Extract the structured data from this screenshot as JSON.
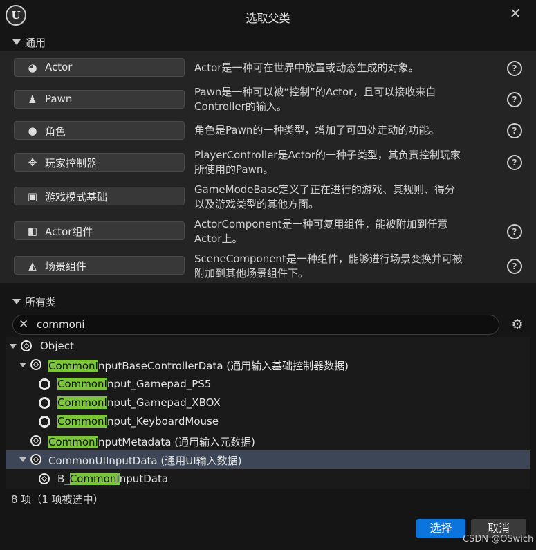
{
  "window": {
    "title": "选取父类"
  },
  "common_section": {
    "label": "通用",
    "items": [
      {
        "label": "Actor",
        "icon": "actor-icon",
        "desc": [
          "Actor是一种可在世界中放置或动态生成的对象。"
        ],
        "help": true
      },
      {
        "label": "Pawn",
        "icon": "pawn-icon",
        "desc": [
          "Pawn是一种可以被“控制”的Actor，且可以接收来自",
          "Controller的输入。"
        ],
        "help": true
      },
      {
        "label": "角色",
        "icon": "character-icon",
        "desc": [
          "角色是Pawn的一种类型，增加了可四处走动的功能。"
        ],
        "help": true
      },
      {
        "label": "玩家控制器",
        "icon": "gamepad-icon",
        "desc": [
          "PlayerController是Actor的一种子类型，其负责控制玩家",
          "所使用的Pawn。"
        ],
        "help": true
      },
      {
        "label": "游戏模式基础",
        "icon": "game-mode-icon",
        "desc": [
          "GameModeBase定义了正在进行的游戏、其规则、得分",
          "以及游戏类型的其他方面。"
        ],
        "help": false
      },
      {
        "label": "Actor组件",
        "icon": "component-icon",
        "desc": [
          "ActorComponent是一种可复用组件，能被附加到任意",
          "Actor上。"
        ],
        "help": true
      },
      {
        "label": "场景组件",
        "icon": "scene-component-icon",
        "desc": [
          "SceneComponent是一种组件，能够进行场景变换并可被",
          "附加到其他场景组件下。"
        ],
        "help": true
      }
    ]
  },
  "all_classes": {
    "label": "所有类",
    "search_value": "commoni",
    "tree": [
      {
        "pre": "",
        "hl": "",
        "post": "Object",
        "icon": "cube",
        "expanded": true,
        "selected": false
      },
      {
        "pre": "",
        "hl": "CommonI",
        "post": "nputBaseControllerData (通用输入基础控制器数据)",
        "icon": "cube",
        "expanded": true,
        "selected": false
      },
      {
        "pre": "",
        "hl": "CommonI",
        "post": "nput_Gamepad_PS5",
        "icon": "ring",
        "expanded": false,
        "selected": false
      },
      {
        "pre": "",
        "hl": "CommonI",
        "post": "nput_Gamepad_XBOX",
        "icon": "ring",
        "expanded": false,
        "selected": false
      },
      {
        "pre": "",
        "hl": "CommonI",
        "post": "nput_KeyboardMouse",
        "icon": "ring",
        "expanded": false,
        "selected": false
      },
      {
        "pre": "",
        "hl": "CommonI",
        "post": "nputMetadata (通用输入元数据)",
        "icon": "cube",
        "expanded": false,
        "selected": false
      },
      {
        "pre": "",
        "hl": "",
        "post": "CommonUIInputData (通用UI输入数据)",
        "icon": "cube",
        "expanded": true,
        "selected": true
      },
      {
        "pre": "B_",
        "hl": "CommonI",
        "post": "nputData",
        "icon": "cube",
        "expanded": false,
        "selected": false
      }
    ],
    "status": "8 项（1 项被选中）"
  },
  "footer": {
    "select_label": "选择",
    "cancel_label": "取消"
  },
  "watermark": "CSDN @OSwich",
  "colors": {
    "accent": "#0c74dd",
    "highlight": "#7ac53a",
    "selected_row": "#3c4656"
  }
}
